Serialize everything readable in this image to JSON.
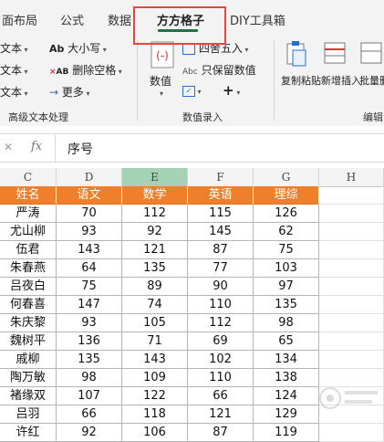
{
  "ribbon": {
    "tabs": [
      {
        "label": "面布局"
      },
      {
        "label": "公式"
      },
      {
        "label": "数据"
      },
      {
        "label": "方方格子"
      },
      {
        "label": "DIY工具箱"
      }
    ],
    "groups": {
      "advanced_text": {
        "title": "高级文本处理",
        "left_items": [
          "文本",
          "文本",
          "文本"
        ],
        "case": "大小写",
        "remove_spaces": "删除空格",
        "more": "更多"
      },
      "numeric_entry": {
        "title": "数值录入",
        "number": "数值",
        "round": "四舍五入",
        "keep_number": "只保留数值",
        "plus": "+"
      },
      "edit": {
        "title": "编辑",
        "copy_paste": "复制粘贴",
        "new_insert": "新增插入",
        "batch_delete": "批量删除"
      }
    }
  },
  "formula_bar": {
    "fx": "fx",
    "value": "序号"
  },
  "columns": [
    "C",
    "D",
    "E",
    "F",
    "G",
    "H"
  ],
  "table": {
    "headers": [
      "姓名",
      "语文",
      "数学",
      "英语",
      "理综"
    ],
    "rows": [
      [
        "严涛",
        "70",
        "112",
        "115",
        "126"
      ],
      [
        "尤山柳",
        "93",
        "92",
        "145",
        "62"
      ],
      [
        "伍君",
        "143",
        "121",
        "87",
        "75"
      ],
      [
        "朱春燕",
        "64",
        "135",
        "77",
        "103"
      ],
      [
        "吕夜白",
        "75",
        "89",
        "90",
        "97"
      ],
      [
        "何春喜",
        "147",
        "74",
        "110",
        "135"
      ],
      [
        "朱庆黎",
        "93",
        "105",
        "112",
        "98"
      ],
      [
        "魏树平",
        "136",
        "71",
        "69",
        "65"
      ],
      [
        "戚柳",
        "135",
        "143",
        "102",
        "134"
      ],
      [
        "陶万敏",
        "98",
        "109",
        "110",
        "138"
      ],
      [
        "褚缘双",
        "107",
        "122",
        "66",
        "124"
      ],
      [
        "吕羽",
        "66",
        "118",
        "121",
        "129"
      ],
      [
        "许红",
        "92",
        "106",
        "87",
        "119"
      ]
    ]
  },
  "colors": {
    "header_fill": "#f07f2c",
    "selected_column": "#a5d1b5",
    "active_tab_underline": "#217346",
    "highlight_box": "#e8453c"
  }
}
